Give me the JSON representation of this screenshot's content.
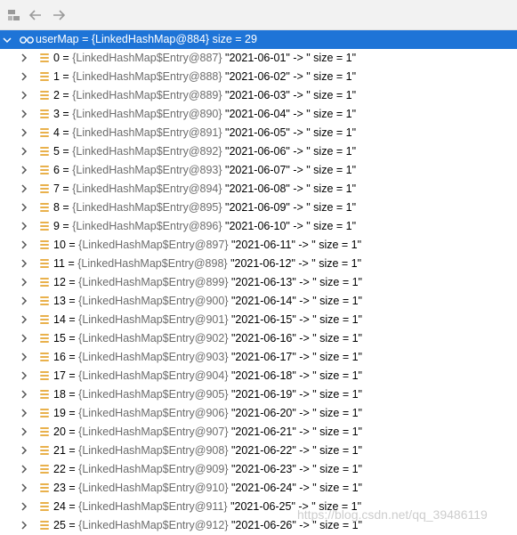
{
  "toolbar": {
    "icons": [
      "layout-icon",
      "back-arrow-icon",
      "forward-arrow-icon"
    ]
  },
  "root": {
    "text": "userMap = {LinkedHashMap@884}  size = 29"
  },
  "entries": [
    {
      "idx": "0",
      "ref": "{LinkedHashMap$Entry@887}",
      "value": "\"2021-06-01\" -> \" size = 1\""
    },
    {
      "idx": "1",
      "ref": "{LinkedHashMap$Entry@888}",
      "value": "\"2021-06-02\" -> \" size = 1\""
    },
    {
      "idx": "2",
      "ref": "{LinkedHashMap$Entry@889}",
      "value": "\"2021-06-03\" -> \" size = 1\""
    },
    {
      "idx": "3",
      "ref": "{LinkedHashMap$Entry@890}",
      "value": "\"2021-06-04\" -> \" size = 1\""
    },
    {
      "idx": "4",
      "ref": "{LinkedHashMap$Entry@891}",
      "value": "\"2021-06-05\" -> \" size = 1\""
    },
    {
      "idx": "5",
      "ref": "{LinkedHashMap$Entry@892}",
      "value": "\"2021-06-06\" -> \" size = 1\""
    },
    {
      "idx": "6",
      "ref": "{LinkedHashMap$Entry@893}",
      "value": "\"2021-06-07\" -> \" size = 1\""
    },
    {
      "idx": "7",
      "ref": "{LinkedHashMap$Entry@894}",
      "value": "\"2021-06-08\" -> \" size = 1\""
    },
    {
      "idx": "8",
      "ref": "{LinkedHashMap$Entry@895}",
      "value": "\"2021-06-09\" -> \" size = 1\""
    },
    {
      "idx": "9",
      "ref": "{LinkedHashMap$Entry@896}",
      "value": "\"2021-06-10\" -> \" size = 1\""
    },
    {
      "idx": "10",
      "ref": "{LinkedHashMap$Entry@897}",
      "value": "\"2021-06-11\" -> \" size = 1\""
    },
    {
      "idx": "11",
      "ref": "{LinkedHashMap$Entry@898}",
      "value": "\"2021-06-12\" -> \" size = 1\""
    },
    {
      "idx": "12",
      "ref": "{LinkedHashMap$Entry@899}",
      "value": "\"2021-06-13\" -> \" size = 1\""
    },
    {
      "idx": "13",
      "ref": "{LinkedHashMap$Entry@900}",
      "value": "\"2021-06-14\" -> \" size = 1\""
    },
    {
      "idx": "14",
      "ref": "{LinkedHashMap$Entry@901}",
      "value": "\"2021-06-15\" -> \" size = 1\""
    },
    {
      "idx": "15",
      "ref": "{LinkedHashMap$Entry@902}",
      "value": "\"2021-06-16\" -> \" size = 1\""
    },
    {
      "idx": "16",
      "ref": "{LinkedHashMap$Entry@903}",
      "value": "\"2021-06-17\" -> \" size = 1\""
    },
    {
      "idx": "17",
      "ref": "{LinkedHashMap$Entry@904}",
      "value": "\"2021-06-18\" -> \" size = 1\""
    },
    {
      "idx": "18",
      "ref": "{LinkedHashMap$Entry@905}",
      "value": "\"2021-06-19\" -> \" size = 1\""
    },
    {
      "idx": "19",
      "ref": "{LinkedHashMap$Entry@906}",
      "value": "\"2021-06-20\" -> \" size = 1\""
    },
    {
      "idx": "20",
      "ref": "{LinkedHashMap$Entry@907}",
      "value": "\"2021-06-21\" -> \" size = 1\""
    },
    {
      "idx": "21",
      "ref": "{LinkedHashMap$Entry@908}",
      "value": "\"2021-06-22\" -> \" size = 1\""
    },
    {
      "idx": "22",
      "ref": "{LinkedHashMap$Entry@909}",
      "value": "\"2021-06-23\" -> \" size = 1\""
    },
    {
      "idx": "23",
      "ref": "{LinkedHashMap$Entry@910}",
      "value": "\"2021-06-24\" -> \" size = 1\""
    },
    {
      "idx": "24",
      "ref": "{LinkedHashMap$Entry@911}",
      "value": "\"2021-06-25\" -> \" size = 1\""
    },
    {
      "idx": "25",
      "ref": "{LinkedHashMap$Entry@912}",
      "value": "\"2021-06-26\" -> \" size = 1\""
    }
  ],
  "watermark": "https://blog.csdn.net/qq_39486119",
  "colors": {
    "selection": "#1e74d7",
    "field_icon": "#e9b14c",
    "ref_text": "#6d6d6d"
  }
}
